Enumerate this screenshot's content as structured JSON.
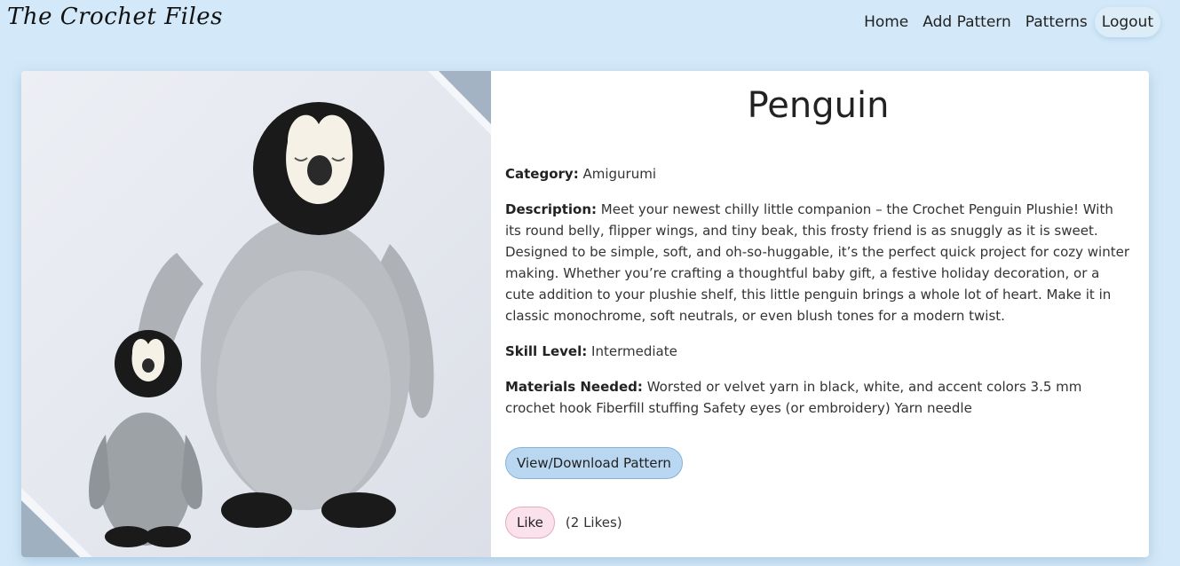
{
  "navbar": {
    "brand": "The Crochet Files",
    "links": [
      "Home",
      "Add Pattern",
      "Patterns",
      "Logout"
    ]
  },
  "pattern": {
    "title": "Penguin",
    "category_label": "Category:",
    "category": "Amigurumi",
    "description_label": "Description:",
    "description": "Meet your newest chilly little companion – the Crochet Penguin Plushie! With its round belly, flipper wings, and tiny beak, this frosty friend is as snuggly as it is sweet. Designed to be simple, soft, and oh-so-huggable, it’s the perfect quick project for cozy winter making. Whether you’re crafting a thoughtful baby gift, a festive holiday decoration, or a cute addition to your plushie shelf, this little penguin brings a whole lot of heart. Make it in classic monochrome, soft neutrals, or even blush tones for a modern twist.",
    "skill_label": "Skill Level:",
    "skill": "Intermediate",
    "materials_label": "Materials Needed:",
    "materials": "Worsted or velvet yarn in black, white, and accent colors 3.5 mm crochet hook Fiberfill stuffing Safety eyes (or embroidery) Yarn needle",
    "view_button": "View/Download Pattern",
    "like_button": "Like",
    "likes_text": "(2 Likes)"
  },
  "colors": {
    "page_bg": "#d3e9f9",
    "view_button_bg": "#b9d7f0",
    "like_button_bg": "#fbe1ec"
  },
  "photo": {
    "subject": "crocheted-penguin-plushies-image"
  }
}
